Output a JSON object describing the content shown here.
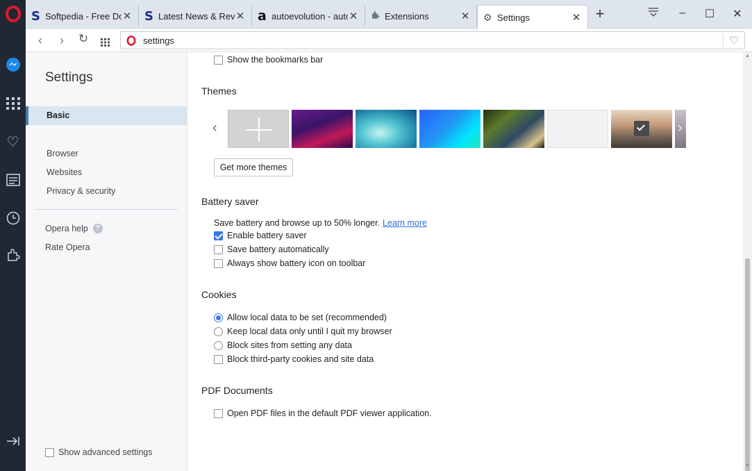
{
  "tabs": [
    {
      "label": "Softpedia - Free Dow",
      "favicon": "softpedia-icon"
    },
    {
      "label": "Latest News & Revie",
      "favicon": "softpedia-icon"
    },
    {
      "label": "autoevolution - auto",
      "favicon": "autoevolution-icon"
    },
    {
      "label": "Extensions",
      "favicon": "puzzle-icon"
    },
    {
      "label": "Settings",
      "favicon": "gear-icon"
    }
  ],
  "address": {
    "url": "settings"
  },
  "left": {
    "title": "Settings",
    "basic": "Basic",
    "browser": "Browser",
    "websites": "Websites",
    "privacy": "Privacy & security",
    "help": "Opera help",
    "help_badge": "?",
    "rate": "Rate Opera",
    "advanced": "Show advanced settings"
  },
  "main": {
    "bookmarks_bar": "Show the bookmarks bar",
    "themes_title": "Themes",
    "themes_button": "Get more themes",
    "battery_title": "Battery saver",
    "battery_desc": "Save battery and browse up to 50% longer.",
    "learn_more": "Learn more",
    "battery_enable": "Enable battery saver",
    "battery_auto": "Save battery automatically",
    "battery_icon": "Always show battery icon on toolbar",
    "cookies_title": "Cookies",
    "cookies_allow": "Allow local data to be set (recommended)",
    "cookies_keep": "Keep local data only until I quit my browser",
    "cookies_block": "Block sites from setting any data",
    "cookies_thirdparty": "Block third-party cookies and site data",
    "pdf_title": "PDF Documents",
    "pdf_open": "Open PDF files in the default PDF viewer application."
  },
  "state": {
    "battery_enable": true,
    "battery_auto": false,
    "battery_icon": false,
    "bookmarks_bar": false,
    "cookies_selected": "cookies_allow",
    "cookies_thirdparty": false,
    "pdf_open": false,
    "advanced": false
  },
  "colors": {
    "accent": "#3b78e7",
    "sidebar": "#202834",
    "opera_red": "#cc1426"
  }
}
